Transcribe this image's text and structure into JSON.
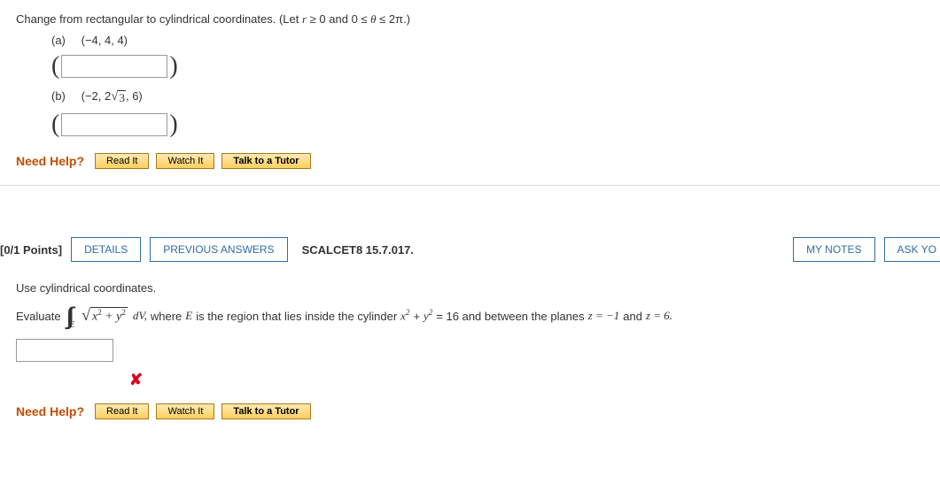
{
  "q1": {
    "prompt_prefix": "Change from rectangular to cylindrical coordinates. (Let ",
    "prompt_mid1": "r",
    "prompt_cond1": " ≥ 0 and 0 ≤ ",
    "prompt_mid2": "θ",
    "prompt_cond2": " ≤ 2π.)",
    "parts": {
      "a": {
        "label": "(a)",
        "coords_plain": "(−4, 4, 4)"
      },
      "b": {
        "label": "(b)",
        "coords_pre": "(−2, 2",
        "coords_rad": "3",
        "coords_post": ", 6)"
      }
    },
    "need_help": "Need Help?",
    "help": {
      "read": "Read It",
      "watch": "Watch It",
      "tutor": "Talk to a Tutor"
    }
  },
  "q2": {
    "points": "[0/1 Points]",
    "details": "DETAILS",
    "previous": "PREVIOUS ANSWERS",
    "source": "SCALCET8 15.7.017.",
    "mynotes": "MY NOTES",
    "ask": "ASK YO",
    "prompt": "Use cylindrical coordinates.",
    "evaluate": "Evaluate",
    "dv": " dV,",
    "where_text": "  where ",
    "E": "E",
    "region_text": " is the region that lies inside the cylinder ",
    "eqn1_lhs": "x",
    "eqn1_plus": " + ",
    "eqn1_y": "y",
    "eqn1_rhs": " = 16 and between the planes ",
    "z1": " z = −1 ",
    "and": " and ",
    "z2": " z = 6.",
    "wrong": "✘",
    "need_help": "Need Help?",
    "help": {
      "read": "Read It",
      "watch": "Watch It",
      "tutor": "Talk to a Tutor"
    }
  },
  "chart_data": {
    "type": "table",
    "note": "Question 2 triple integral problem",
    "integrand": "sqrt(x^2 + y^2)",
    "region": {
      "cylinder": "x^2 + y^2 = 16",
      "z_range": [
        -1,
        6
      ]
    }
  }
}
